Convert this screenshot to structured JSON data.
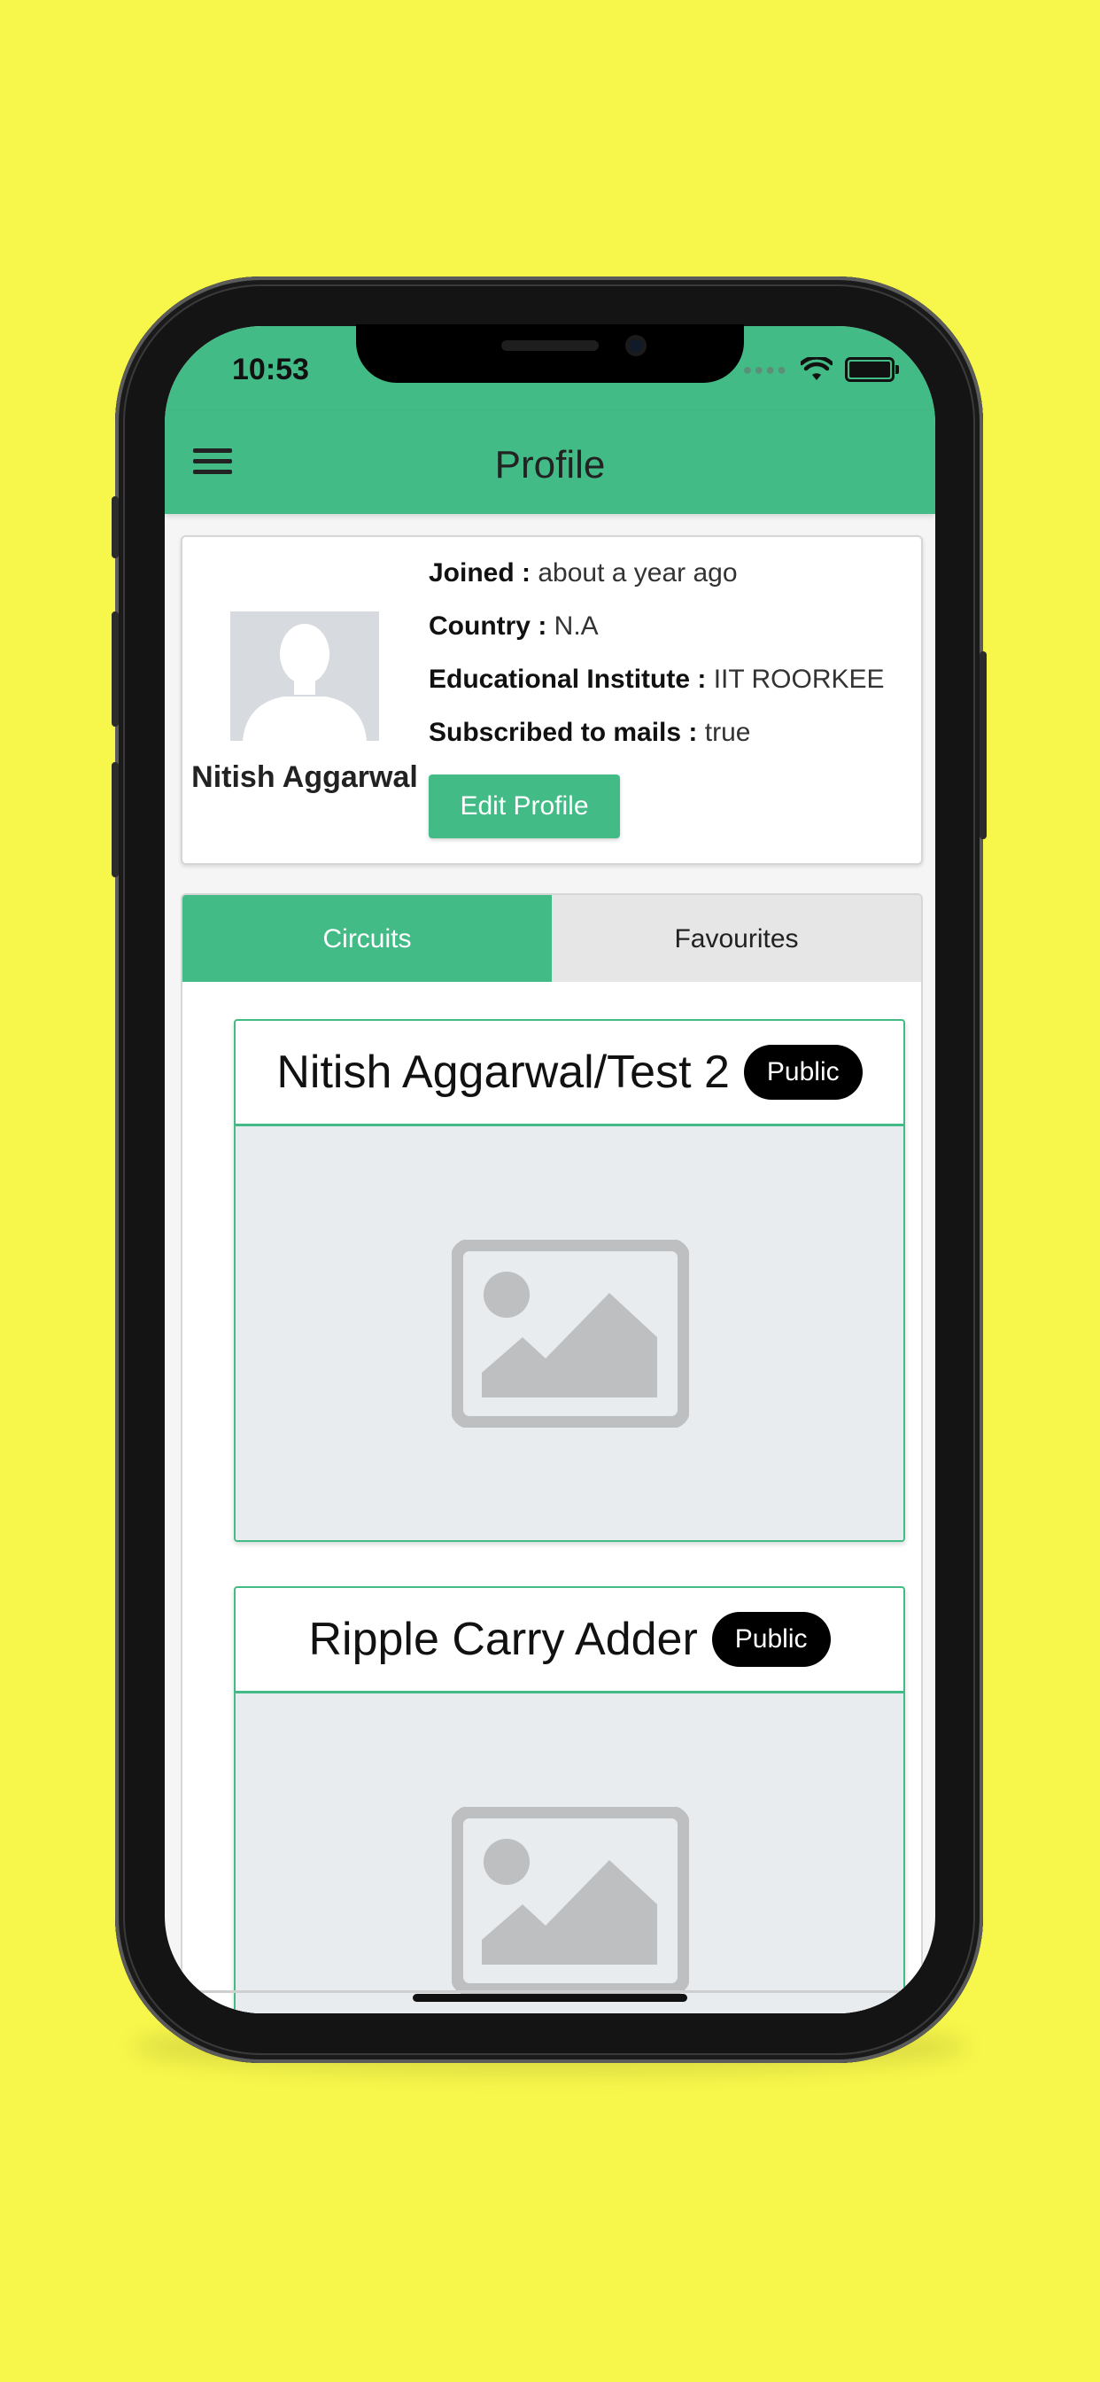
{
  "status_bar": {
    "time": "10:53"
  },
  "app_bar": {
    "title": "Profile",
    "menu_icon": "hamburger-menu-icon"
  },
  "profile": {
    "name": "Nitish Aggarwal",
    "avatar_icon": "user-silhouette-icon",
    "joined_label": "Joined :",
    "joined_value": "about a year ago",
    "country_label": "Country :",
    "country_value": "N.A",
    "institute_label": "Educational Institute :",
    "institute_value": "IIT ROORKEE",
    "mails_label": "Subscribed to mails :",
    "mails_value": "true",
    "edit_button": "Edit Profile"
  },
  "tabs": [
    {
      "label": "Circuits",
      "active": true
    },
    {
      "label": "Favourites",
      "active": false
    }
  ],
  "circuits": [
    {
      "title": "Nitish Aggarwal/Test 2",
      "badge": "Public",
      "thumbnail_icon": "image-placeholder-icon"
    },
    {
      "title": "Ripple Carry Adder",
      "badge": "Public",
      "thumbnail_icon": "image-placeholder-icon"
    }
  ],
  "colors": {
    "background": "#f6f64b",
    "accent": "#43bb86",
    "badge": "#000000"
  }
}
